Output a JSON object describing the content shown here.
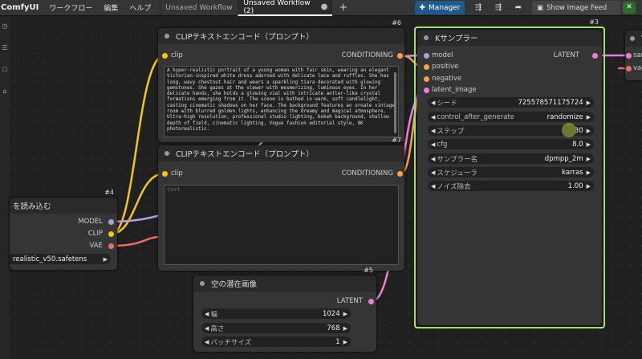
{
  "topbar": {
    "logo": "ComfyUI",
    "menu": [
      "ワークフロー",
      "編集",
      "ヘルプ"
    ],
    "tabs": [
      {
        "label": "Unsaved Workflow",
        "active": false
      },
      {
        "label": "Unsaved Workflow (2)",
        "active": true
      }
    ],
    "tab_close": "●",
    "tab_add": "+",
    "manager_label": "Manager",
    "feed_label": "Show Image Feed",
    "feed_close": "✕"
  },
  "colors": {
    "clip": "#f5c518",
    "conditioning": "#f5a24a",
    "model": "#b39ddb",
    "latent": "#f07cdb",
    "vae": "#f06a6a",
    "highlight": "#a3e57a"
  },
  "nodes": {
    "clip1": {
      "id": "#6",
      "title": "CLIPテキストエンコード（プロンプト）",
      "input": "clip",
      "output": "CONDITIONING",
      "text": "A hyper-realistic portrait of a young woman with fair skin, wearing an elegant Victorian-inspired white dress adorned with delicate lace and ruffles. She has long, wavy chestnut hair and wears a sparkling tiara decorated with glowing gemstones. She gazes at the viewer with mesmerizing, luminous eyes. In her delicate hands, she holds a glowing vial with intricate antler-like crystal formations emerging from it. The scene is bathed in warm, soft candlelight, casting cinematic shadows on her face. The background features an ornate vintage room with blurred golden lights, enhancing the dreamy and magical atmosphere. Ultra-high resolution, professional studio lighting, bokeh background, shallow depth of field, cinematic lighting, Vogue fashion editorial style, 8K photorealistic."
    },
    "clip2": {
      "id": "#7",
      "title": "CLIPテキストエンコード（プロンプト）",
      "input": "clip",
      "output": "CONDITIONING",
      "placeholder": "text"
    },
    "loader": {
      "id": "#4",
      "title": "を読み込む",
      "outputs": [
        "MODEL",
        "CLIP",
        "VAE"
      ],
      "ckpt": "realistic_v50.safetens"
    },
    "latent": {
      "id": "#5",
      "title": "空の潜在画像",
      "output": "LATENT",
      "widgets": [
        {
          "label": "幅",
          "value": "1024"
        },
        {
          "label": "高さ",
          "value": "768"
        },
        {
          "label": "バッチサイズ",
          "value": "1"
        }
      ]
    },
    "ksampler": {
      "id": "#3",
      "title": "Kサンプラー",
      "inputs": [
        "model",
        "positive",
        "negative",
        "latent_image"
      ],
      "output": "LATENT",
      "widgets": [
        {
          "label": "シード",
          "value": "725578571175724"
        },
        {
          "label": "control_after_generate",
          "value": "randomize"
        },
        {
          "label": "ステップ",
          "value": "30"
        },
        {
          "label": "cfg",
          "value": "8.0"
        },
        {
          "label": "サンプラー名",
          "value": "dpmpp_2m"
        },
        {
          "label": "スケジューラ",
          "value": "karras"
        },
        {
          "label": "ノイズ除去",
          "value": "1.00"
        }
      ]
    },
    "vae": {
      "title": "V",
      "inputs": [
        "sar",
        "vae"
      ]
    }
  }
}
